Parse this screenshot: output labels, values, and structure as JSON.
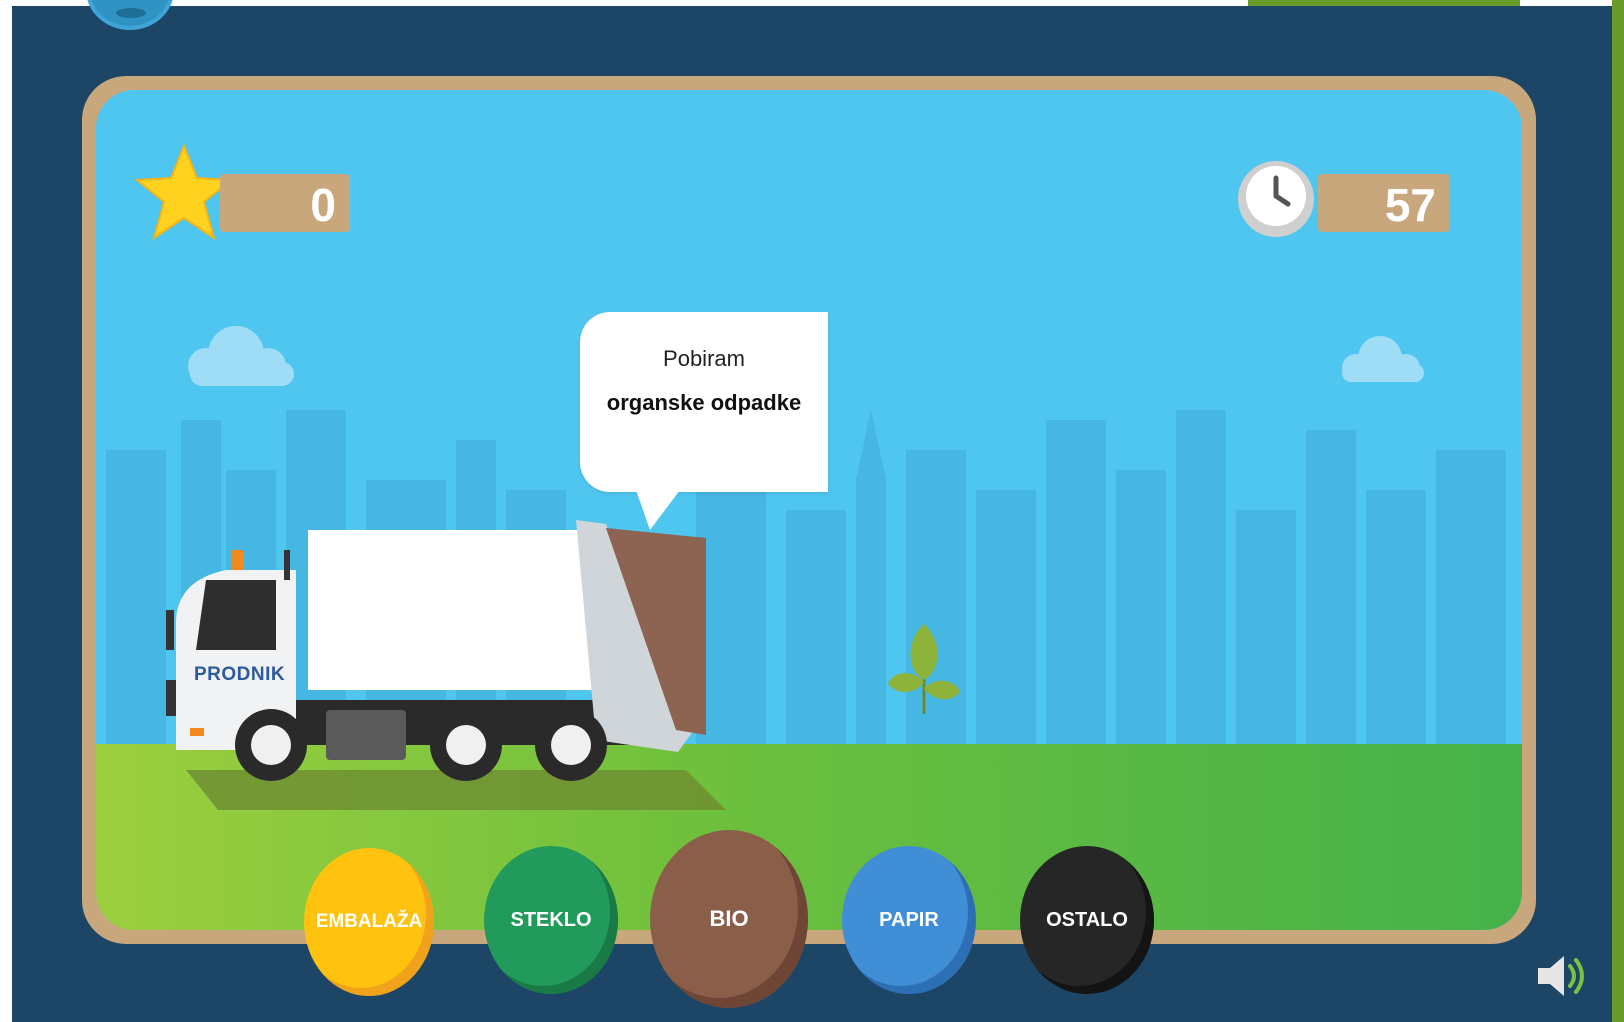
{
  "hud": {
    "score": "0",
    "timer": "57"
  },
  "truck": {
    "brand": "PRODNIK"
  },
  "speech": {
    "line1": "Pobiram",
    "line2": "organske odpadke"
  },
  "bins": [
    {
      "label": "EMBALAŽA"
    },
    {
      "label": "STEKLO"
    },
    {
      "label": "BIO"
    },
    {
      "label": "PAPIR"
    },
    {
      "label": "OSTALO"
    }
  ],
  "icons": {
    "score": "star-icon",
    "timer": "clock-icon",
    "sound": "speaker-icon",
    "plant": "leaf-icon"
  },
  "colors": {
    "frame": "#1c4566",
    "board_border": "#c9a77c",
    "sky": "#4ec6f0",
    "embalaza": "#ffc20e",
    "steklo": "#229a5b",
    "bio": "#8b5e4a",
    "papir": "#3f8ed6",
    "ostalo": "#262626"
  }
}
